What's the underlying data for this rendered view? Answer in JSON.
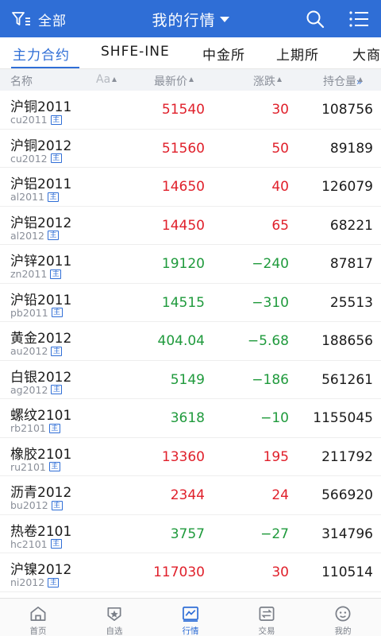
{
  "topbar": {
    "filter_label": "全部",
    "title": "我的行情"
  },
  "tabs": [
    {
      "label": "主力合约",
      "active": true
    },
    {
      "label": "SHFE-INE",
      "active": false
    },
    {
      "label": "中金所",
      "active": false
    },
    {
      "label": "上期所",
      "active": false
    },
    {
      "label": "大商",
      "active": false
    }
  ],
  "columns": {
    "name": "名称",
    "font_toggle": "Aa",
    "price": "最新价",
    "change": "涨跌",
    "open_interest": "持仓量",
    "more": "»"
  },
  "main_badge": "主",
  "rows": [
    {
      "name": "沪铜2011",
      "code": "cu2011",
      "price": "51540",
      "change": "30",
      "oi": "108756",
      "trend": "up"
    },
    {
      "name": "沪铜2012",
      "code": "cu2012",
      "price": "51560",
      "change": "50",
      "oi": "89189",
      "trend": "up"
    },
    {
      "name": "沪铝2011",
      "code": "al2011",
      "price": "14650",
      "change": "40",
      "oi": "126079",
      "trend": "up"
    },
    {
      "name": "沪铝2012",
      "code": "al2012",
      "price": "14450",
      "change": "65",
      "oi": "68221",
      "trend": "up"
    },
    {
      "name": "沪锌2011",
      "code": "zn2011",
      "price": "19120",
      "change": "−240",
      "oi": "87817",
      "trend": "down"
    },
    {
      "name": "沪铅2011",
      "code": "pb2011",
      "price": "14515",
      "change": "−310",
      "oi": "25513",
      "trend": "down"
    },
    {
      "name": "黄金2012",
      "code": "au2012",
      "price": "404.04",
      "change": "−5.68",
      "oi": "188656",
      "trend": "down"
    },
    {
      "name": "白银2012",
      "code": "ag2012",
      "price": "5149",
      "change": "−186",
      "oi": "561261",
      "trend": "down"
    },
    {
      "name": "螺纹2101",
      "code": "rb2101",
      "price": "3618",
      "change": "−10",
      "oi": "1155045",
      "trend": "down"
    },
    {
      "name": "橡胶2101",
      "code": "ru2101",
      "price": "13360",
      "change": "195",
      "oi": "211792",
      "trend": "up"
    },
    {
      "name": "沥青2012",
      "code": "bu2012",
      "price": "2344",
      "change": "24",
      "oi": "566920",
      "trend": "up"
    },
    {
      "name": "热卷2101",
      "code": "hc2101",
      "price": "3757",
      "change": "−27",
      "oi": "314796",
      "trend": "down"
    },
    {
      "name": "沪镍2012",
      "code": "ni2012",
      "price": "117030",
      "change": "30",
      "oi": "110514",
      "trend": "up"
    }
  ],
  "bottomnav": [
    {
      "label": "首页",
      "icon": "home-icon",
      "active": false
    },
    {
      "label": "自选",
      "icon": "star-shield-icon",
      "active": false
    },
    {
      "label": "行情",
      "icon": "market-chart-icon",
      "active": true
    },
    {
      "label": "交易",
      "icon": "trade-exchange-icon",
      "active": false
    },
    {
      "label": "我的",
      "icon": "profile-face-icon",
      "active": false
    }
  ],
  "colors": {
    "brand": "#2f6ed6",
    "up": "#e0202b",
    "down": "#1f9a3c"
  }
}
